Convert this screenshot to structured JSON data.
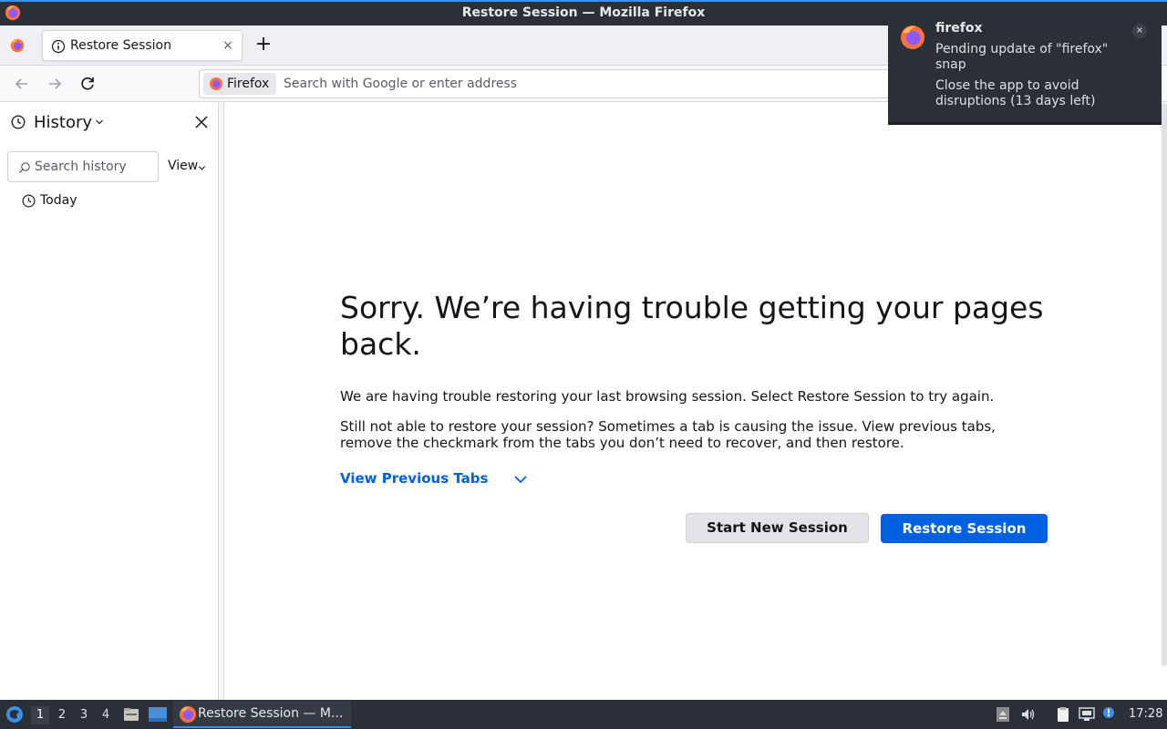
{
  "window": {
    "title": "Restore Session — Mozilla Firefox"
  },
  "tabs": [
    {
      "label": "Restore Session",
      "close": "×"
    }
  ],
  "newtab_symbol": "+",
  "urlbar": {
    "identity": "Firefox",
    "placeholder": "Search with Google or enter address"
  },
  "sidebar": {
    "title": "History",
    "search_placeholder": "Search history",
    "view_label": "View",
    "groups": [
      {
        "label": "Today"
      }
    ]
  },
  "content": {
    "heading": "Sorry. We’re having trouble getting your pages back.",
    "para1": "We are having trouble restoring your last browsing session. Select Restore Session to try again.",
    "para2": "Still not able to restore your session? Sometimes a tab is causing the issue. View previous tabs, remove the checkmark from the tabs you don’t need to recover, and then restore.",
    "view_previous_tabs": "View Previous Tabs",
    "start_new_session": "Start New Session",
    "restore_session": "Restore Session"
  },
  "notification": {
    "app": "firefox",
    "line1": "Pending update of \"firefox\" snap",
    "line2": "Close the app to avoid disruptions (13 days left)",
    "close": "×"
  },
  "taskbar": {
    "workspaces": [
      "1",
      "2",
      "3",
      "4"
    ],
    "active_workspace": "1",
    "task_label": "Restore Session — M...",
    "clock": "17:28"
  },
  "colors": {
    "accent": "#0061e0",
    "titlebar_bg": "#2b3038",
    "taskbar_bg": "#2b3038",
    "firefox_orange": "#ff7139",
    "firefox_purple": "#9059ff"
  }
}
